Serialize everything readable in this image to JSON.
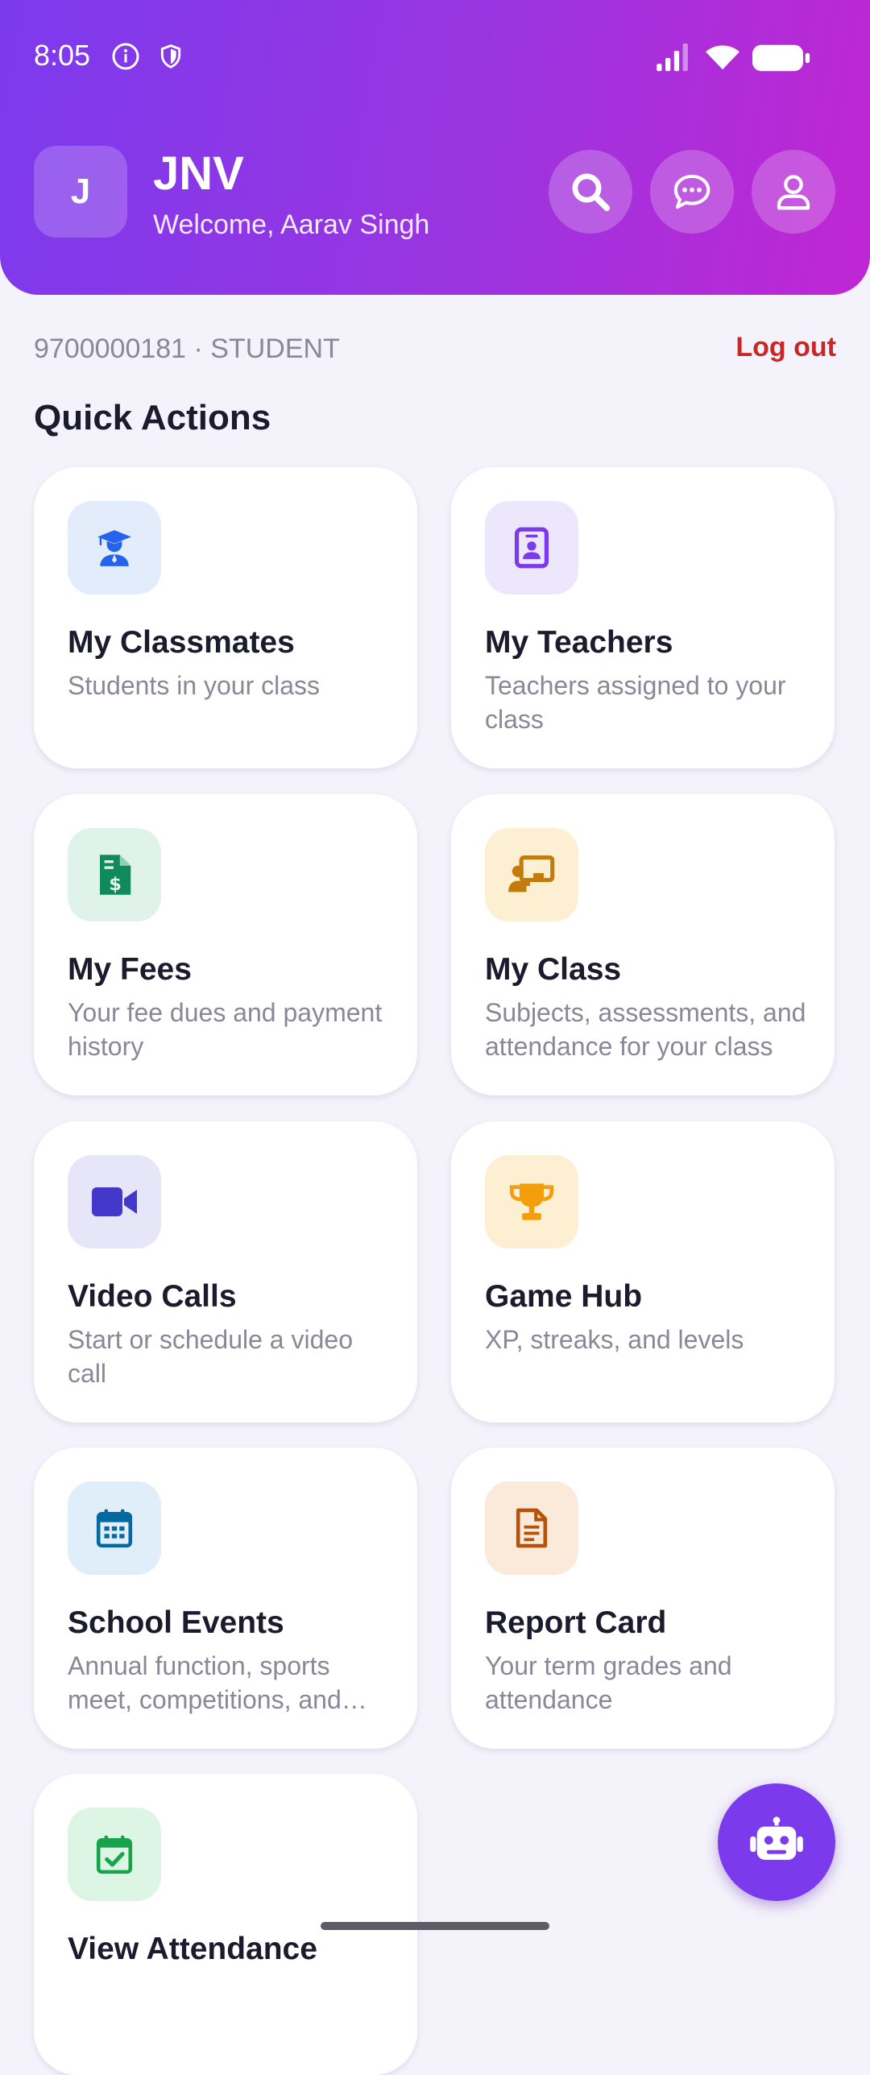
{
  "status_bar": {
    "time": "8:05"
  },
  "header": {
    "logo_letter": "J",
    "app_title": "JNV",
    "welcome": "Welcome, Aarav Singh"
  },
  "account": {
    "info": "9700000181 · STUDENT",
    "logout_label": "Log out"
  },
  "quick_actions": {
    "title": "Quick Actions",
    "cards": [
      {
        "title": "My Classmates",
        "subtitle": "Students in your class",
        "icon": "graduate-icon",
        "bg": "#e3ecfb",
        "fg": "#2563eb"
      },
      {
        "title": "My Teachers",
        "subtitle": "Teachers assigned to your class",
        "icon": "id-badge-icon",
        "bg": "#ece7fa",
        "fg": "#7c3aed"
      },
      {
        "title": "My Fees",
        "subtitle": "Your fee dues and payment history",
        "icon": "invoice-icon",
        "bg": "#dff3ea",
        "fg": "#0f8a5f"
      },
      {
        "title": "My Class",
        "subtitle": "Subjects, assessments, and attendance for your class",
        "icon": "teacher-board-icon",
        "bg": "#fdf0d2",
        "fg": "#c27c0e"
      },
      {
        "title": "Video Calls",
        "subtitle": "Start or schedule a video call",
        "icon": "video-camera-icon",
        "bg": "#e7e5f8",
        "fg": "#4338ca"
      },
      {
        "title": "Game Hub",
        "subtitle": "XP, streaks, and levels",
        "icon": "trophy-icon",
        "bg": "#fdf0d2",
        "fg": "#f59e0b"
      },
      {
        "title": "School Events",
        "subtitle": "Annual function, sports meet, competitions, and more",
        "icon": "calendar-icon",
        "bg": "#e0eefa",
        "fg": "#0369a1"
      },
      {
        "title": "Report Card",
        "subtitle": "Your term grades and attendance",
        "icon": "document-icon",
        "bg": "#fbe9da",
        "fg": "#b45309"
      },
      {
        "title": "View Attendance",
        "subtitle": "",
        "icon": "calendar-check-icon",
        "bg": "#ddf5e5",
        "fg": "#16a34a"
      }
    ]
  },
  "colors": {
    "accent": "#7c3aed",
    "logout": "#c62828"
  }
}
